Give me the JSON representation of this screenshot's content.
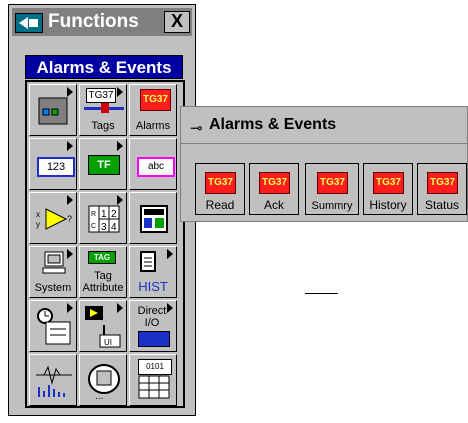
{
  "functions_window": {
    "title": "Functions",
    "close_label": "X",
    "section_header": "Alarms & Events",
    "tiles": [
      {
        "label": ""
      },
      {
        "label": "Tags",
        "badge": "TG37"
      },
      {
        "label": "Alarms",
        "badge": "TG37"
      },
      {
        "label": "",
        "glyph": "123"
      },
      {
        "label": "",
        "glyph": "TF"
      },
      {
        "label": "",
        "glyph": "abc"
      },
      {
        "label": ""
      },
      {
        "label": "",
        "glyph": "R 1 2 / 3 4"
      },
      {
        "label": ""
      },
      {
        "label": "System"
      },
      {
        "label": "Tag Attribute",
        "badge": "TAG"
      },
      {
        "label": "HIST"
      },
      {
        "label": ""
      },
      {
        "label": "",
        "glyph": "UI"
      },
      {
        "label": "Direct I/O",
        "glyph": "I/O"
      },
      {
        "label": ""
      },
      {
        "label": ""
      },
      {
        "label": "",
        "glyph": "0101"
      }
    ]
  },
  "alarms_palette": {
    "title": "Alarms & Events",
    "pin_icon": "⊸",
    "tiles": [
      {
        "badge": "TG37",
        "label": "Read"
      },
      {
        "badge": "TG37",
        "label": "Ack"
      },
      {
        "badge": "TG37",
        "label": "Summry"
      },
      {
        "badge": "TG37",
        "label": "History"
      },
      {
        "badge": "TG37",
        "label": "Status"
      }
    ]
  },
  "colors": {
    "title_bar": "#808080",
    "header_blue": "#0000a0",
    "tag_red": "#ff1e1e",
    "palette_grey": "#c0c0c0"
  }
}
